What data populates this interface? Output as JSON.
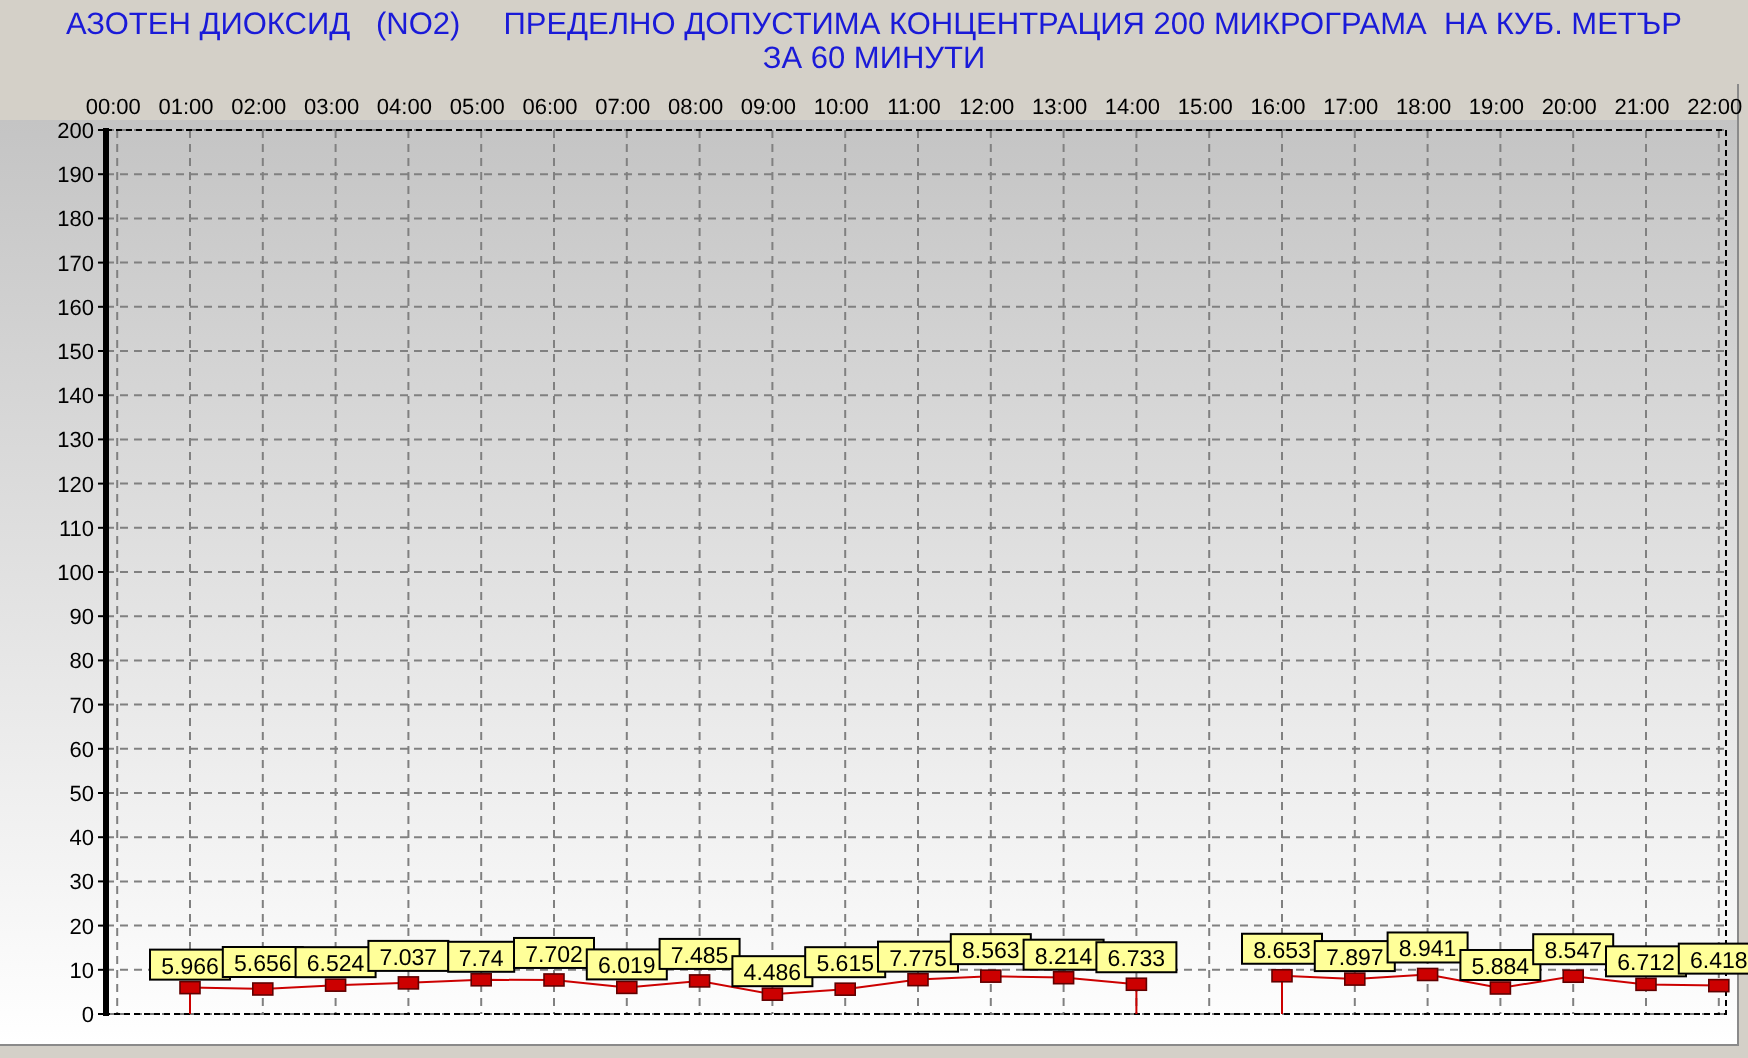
{
  "title_lines": [
    "АЗОТЕН ДИОКСИД   (NO2)     ПРЕДЕЛНО ДОПУСТИМА КОНЦЕНТРАЦИЯ 200 МИКРОГРАМА  НА КУБ. МЕТЪР",
    "ЗА 60 МИНУТИ"
  ],
  "chart_data": {
    "type": "line",
    "categories": [
      "00:00",
      "01:00",
      "02:00",
      "03:00",
      "04:00",
      "05:00",
      "06:00",
      "07:00",
      "08:00",
      "09:00",
      "10:00",
      "11:00",
      "12:00",
      "13:00",
      "14:00",
      "15:00",
      "16:00",
      "17:00",
      "18:00",
      "19:00",
      "20:00",
      "21:00",
      "22:00"
    ],
    "series": [
      {
        "color": "#cc0000",
        "marker": "square",
        "values": [
          null,
          5.966,
          5.656,
          6.524,
          7.037,
          7.74,
          7.702,
          6.019,
          7.485,
          4.486,
          5.615,
          7.775,
          8.563,
          8.214,
          6.733,
          null,
          8.653,
          7.897,
          8.941,
          5.884,
          8.547,
          6.712,
          6.418
        ]
      }
    ],
    "ylim": [
      0,
      200
    ],
    "yticks": [
      0,
      10,
      20,
      30,
      40,
      50,
      60,
      70,
      80,
      90,
      100,
      110,
      120,
      130,
      140,
      150,
      160,
      170,
      180,
      190,
      200
    ],
    "data_labels": true,
    "grid": true
  }
}
